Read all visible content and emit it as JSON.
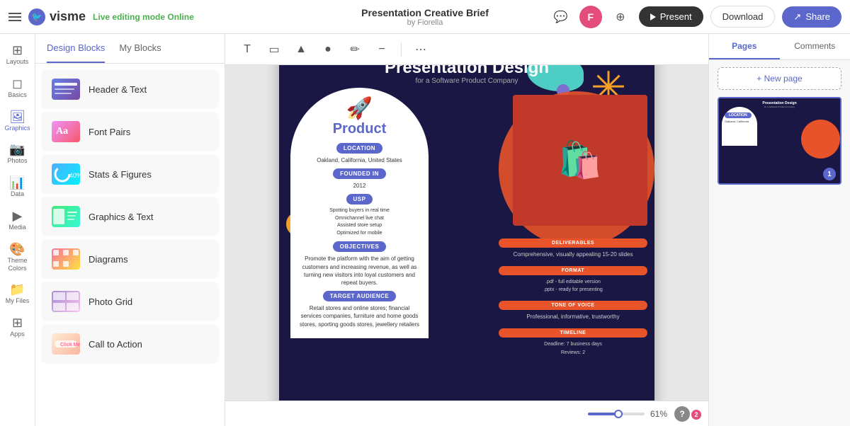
{
  "topbar": {
    "title": "Presentation Creative Brief",
    "author": "by Fiorella",
    "editing_mode": "Live editing mode",
    "online_label": "Online",
    "present_label": "Present",
    "download_label": "Download",
    "share_label": "Share",
    "avatar_initials": "F"
  },
  "canvas_toolbar": {
    "tools": [
      "T",
      "▭",
      "▲",
      "●",
      "✏",
      "−",
      "⋯"
    ]
  },
  "panel": {
    "tab1": "Design Blocks",
    "tab2": "My Blocks",
    "blocks": [
      {
        "label": "Header & Text",
        "id": "header-text"
      },
      {
        "label": "Font Pairs",
        "id": "font-pairs"
      },
      {
        "label": "Stats & Figures",
        "id": "stats-figures"
      },
      {
        "label": "Graphics & Text",
        "id": "graphics-text"
      },
      {
        "label": "Diagrams",
        "id": "diagrams"
      },
      {
        "label": "Photo Grid",
        "id": "photo-grid"
      },
      {
        "label": "Call to Action",
        "id": "call-to-action"
      }
    ]
  },
  "left_sidebar": {
    "items": [
      {
        "id": "layouts",
        "label": "Layouts",
        "icon": "⊞"
      },
      {
        "id": "basics",
        "label": "Basics",
        "icon": "◻"
      },
      {
        "id": "graphics",
        "label": "Graphics",
        "icon": "🖼"
      },
      {
        "id": "photos",
        "label": "Photos",
        "icon": "📷"
      },
      {
        "id": "data",
        "label": "Data",
        "icon": "📊"
      },
      {
        "id": "media",
        "label": "Media",
        "icon": "▶"
      },
      {
        "id": "theme-colors",
        "label": "Theme Colors",
        "icon": "🎨"
      },
      {
        "id": "my-files",
        "label": "My Files",
        "icon": "📁"
      },
      {
        "id": "apps",
        "label": "Apps",
        "icon": "⊞"
      }
    ]
  },
  "slide": {
    "main_title": "Presentation Design",
    "subtitle": "for a Software Product Company",
    "product_label": "Product",
    "location_label": "LOCATION",
    "location_value": "Oakland, California, United States",
    "founded_label": "FOUNDED IN",
    "founded_value": "2012",
    "usp_label": "USP",
    "usp_value": "Spotting buyers in real time\nOmnichannel live chat\nAssisted store setup\nOptimized for mobile",
    "objectives_label": "OBJECTIVES",
    "objectives_value": "Promote the platform with the aim of getting customers and increasing revenue, as well as turning new visitors into loyal customers and repeat buyers.",
    "target_label": "TARGET AUDIENCE",
    "target_value": "Retail stores and online stores; financial services companies, furniture and home goods stores, sporting goods stores, jewellery retailers",
    "deliverables_label": "DELIVERABLES",
    "deliverables_value": "Comprehensive, visually appealing 15-20 slides",
    "format_label": "FORMAT",
    "format_value": ".pdf - full editable version\n.pptx - ready for presenting",
    "tone_label": "TONE OF VOICE",
    "tone_value": "Professional, informative, trustworthy",
    "timeline_label": "TIMELINE",
    "timeline_value": "Deadline: 7 business days\nReviews: 2"
  },
  "right_panel": {
    "tab1": "Pages",
    "tab2": "Comments",
    "new_page_label": "+ New page",
    "page_number": "1"
  },
  "zoom": {
    "level": "61%",
    "help": "?"
  }
}
